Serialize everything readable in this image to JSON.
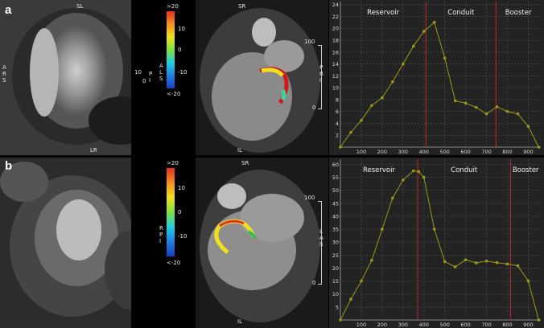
{
  "figure": {
    "panels": [
      {
        "tag": "a",
        "short_axis": {
          "top": "SL",
          "bottom": "LR",
          "left": "A\nR\nS"
        },
        "long_axis": {
          "top": "SR",
          "bottom": "IL",
          "right": "P\nR\nI"
        },
        "colorbar": {
          "top": ">20",
          "bottom": "<-20",
          "ticks": [
            "10",
            "0",
            "-10"
          ],
          "side": "A\nL\nS",
          "left_ticks": [
            "10",
            "0"
          ],
          "left_side": "P\nI"
        },
        "scale": {
          "top": "100",
          "bottom": "0"
        }
      },
      {
        "tag": "b",
        "long_axis": {
          "top": "SR",
          "bottom": "IL",
          "right": "L\nA\nS"
        },
        "colorbar": {
          "top": ">20",
          "bottom": "<-20",
          "ticks": [
            "10",
            "0",
            "-10"
          ],
          "side": "R\nP\nI"
        },
        "scale": {
          "top": "100",
          "bottom": "0"
        }
      }
    ]
  },
  "chart_data": [
    {
      "type": "line",
      "phases": [
        "Reservoir",
        "Conduit",
        "Booster"
      ],
      "phase_lines_x": [
        410,
        745
      ],
      "x": [
        0,
        50,
        100,
        150,
        200,
        250,
        300,
        350,
        400,
        450,
        500,
        550,
        600,
        650,
        700,
        750,
        800,
        850,
        900,
        950
      ],
      "y": [
        0,
        2.5,
        4.5,
        7,
        8.3,
        11,
        14,
        17,
        19.5,
        21,
        15,
        7.8,
        7.4,
        6.7,
        5.6,
        6.8,
        6,
        5.6,
        3.5,
        0
      ],
      "x_ticks": [
        "100",
        "200",
        "300",
        "400",
        "500",
        "600",
        "700",
        "800",
        "900"
      ],
      "y_ticks": [
        "2",
        "4",
        "6",
        "8",
        "10",
        "12",
        "14",
        "16",
        "18",
        "20",
        "22",
        "24"
      ],
      "xlim": [
        0,
        960
      ],
      "ylim": [
        0,
        24.5
      ],
      "line_color": "#9a9a18",
      "phase_color": "#c0282a"
    },
    {
      "type": "line",
      "phases": [
        "Reservoir",
        "Conduit",
        "Booster"
      ],
      "phase_lines_x": [
        370,
        815
      ],
      "x": [
        0,
        50,
        100,
        150,
        200,
        250,
        300,
        350,
        375,
        400,
        450,
        500,
        550,
        600,
        650,
        700,
        750,
        800,
        850,
        900,
        950
      ],
      "y": [
        0,
        8,
        15,
        23,
        35,
        47,
        54,
        57.5,
        57.2,
        55,
        35,
        22.5,
        20.5,
        23.2,
        22,
        22.7,
        22.1,
        21.6,
        20.9,
        15,
        0
      ],
      "x_ticks": [
        "100",
        "200",
        "300",
        "400",
        "500",
        "600",
        "700",
        "800",
        "900"
      ],
      "y_ticks": [
        "5",
        "10",
        "15",
        "20",
        "25",
        "30",
        "35",
        "40",
        "45",
        "50",
        "55",
        "60"
      ],
      "xlim": [
        0,
        960
      ],
      "ylim": [
        0,
        62
      ],
      "line_color": "#9a9a18",
      "phase_color": "#c0282a"
    }
  ]
}
